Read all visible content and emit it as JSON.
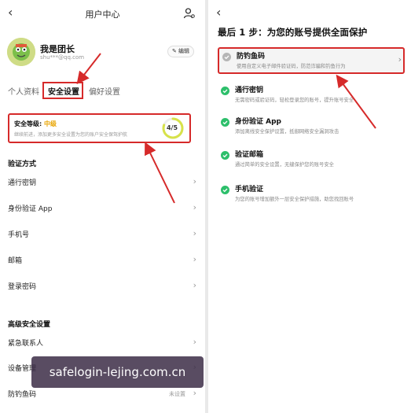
{
  "left": {
    "header_title": "用户中心",
    "back_icon": "chevron-left-icon",
    "profile": {
      "name": "我是团长",
      "email": "shu***@qq.com",
      "edit_label": "编辑"
    },
    "tabs": [
      {
        "label": "个人资料",
        "active": false
      },
      {
        "label": "安全设置",
        "active": true
      },
      {
        "label": "偏好设置",
        "active": false
      }
    ],
    "security_card": {
      "title_prefix": "安全等级:",
      "level": "中级",
      "description": "继续前进，添加更多安全设置为您的账户安全保驾护航",
      "score": "4/5",
      "progress": 0.8
    },
    "verify_section": {
      "title": "验证方式",
      "items": [
        {
          "label": "通行密钥"
        },
        {
          "label": "身份验证 App"
        },
        {
          "label": "手机号"
        },
        {
          "label": "邮箱"
        },
        {
          "label": "登录密码"
        }
      ]
    },
    "advanced_section": {
      "title": "高级安全设置",
      "items": [
        {
          "label": "紧急联系人",
          "value": ""
        },
        {
          "label": "设备管理",
          "value": ""
        },
        {
          "label": "防钓鱼码",
          "value": "未设置"
        }
      ]
    },
    "watermark": "safelogin-lejing.com.cn"
  },
  "right": {
    "title": "最后 1 步：为您的账号提供全面保护",
    "items": [
      {
        "title": "防钓鱼码",
        "desc": "使用自定义电子邮件验证码，防范诈骗和钓鱼行为",
        "status": "pending"
      },
      {
        "title": "通行密钥",
        "desc": "无需密码或验证码，轻松登录您的账号，提升账号安全",
        "status": "done"
      },
      {
        "title": "身份验证 App",
        "desc": "添加离线安全保护设置，抵御网络安全漏洞攻击",
        "status": "done"
      },
      {
        "title": "验证邮箱",
        "desc": "通过简单的安全设置，无缝保护您的账号安全",
        "status": "done"
      },
      {
        "title": "手机验证",
        "desc": "为您的账号增加额外一层安全保护措施，助您找回账号",
        "status": "done"
      }
    ]
  },
  "colors": {
    "accent_red": "#d62a2a",
    "level_orange": "#e8a400",
    "check_green": "#2dbf6b",
    "pending_gray": "#b5b5b5"
  }
}
